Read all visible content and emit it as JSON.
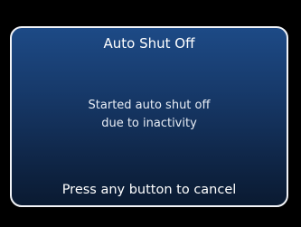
{
  "dialog": {
    "title": "Auto Shut Off",
    "message_line1": "Started auto shut off",
    "message_line2": "due to inactivity",
    "footer": "Press any button to cancel"
  },
  "colors": {
    "background": "#000000",
    "panel_top": "#1d4a86",
    "panel_bottom": "#0a1a31",
    "border": "#f2f4f8",
    "text": "#ffffff"
  }
}
